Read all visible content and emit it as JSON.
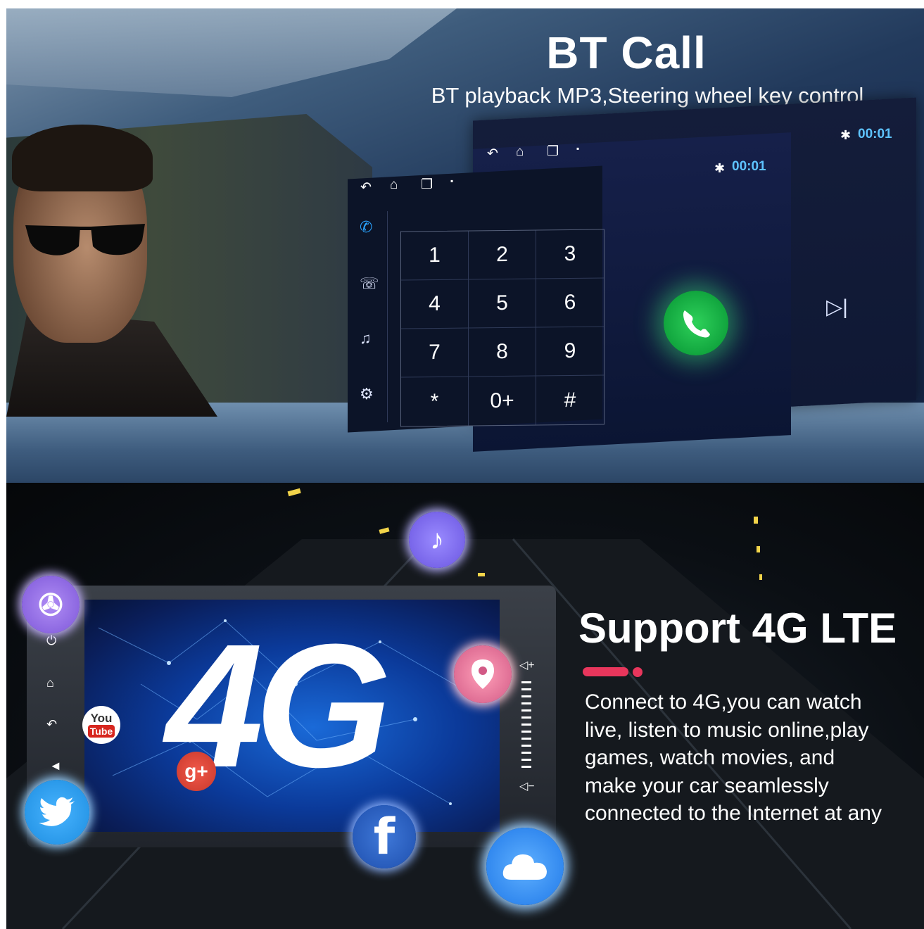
{
  "top": {
    "title": "BT Call",
    "subtitle": "BT playback MP3,Steering wheel key control",
    "time": "00:01",
    "keypad_keys": [
      "1",
      "2",
      "3",
      "4",
      "5",
      "6",
      "7",
      "8",
      "9",
      "*",
      "0+",
      "#"
    ]
  },
  "bottom": {
    "headline": "Support 4G LTE",
    "big_label": "4G",
    "description_lines": [
      "Connect to 4G,you can watch",
      "live,  listen to music online,play",
      "games,  watch movies,  and",
      "make your car seamlessly",
      "connected to the Internet at any"
    ],
    "app_icons": [
      "music-icon",
      "video-icon",
      "location-icon",
      "youtube-icon",
      "google-plus-icon",
      "twitter-icon",
      "facebook-icon",
      "cloud-icon"
    ],
    "youtube_label_1": "You",
    "youtube_label_2": "Tube",
    "gplus_label": "g+",
    "facebook_label": "f"
  },
  "colors": {
    "accent_pink": "#e8365c",
    "time_blue": "#5ec3ff",
    "call_green": "#11a53e"
  }
}
